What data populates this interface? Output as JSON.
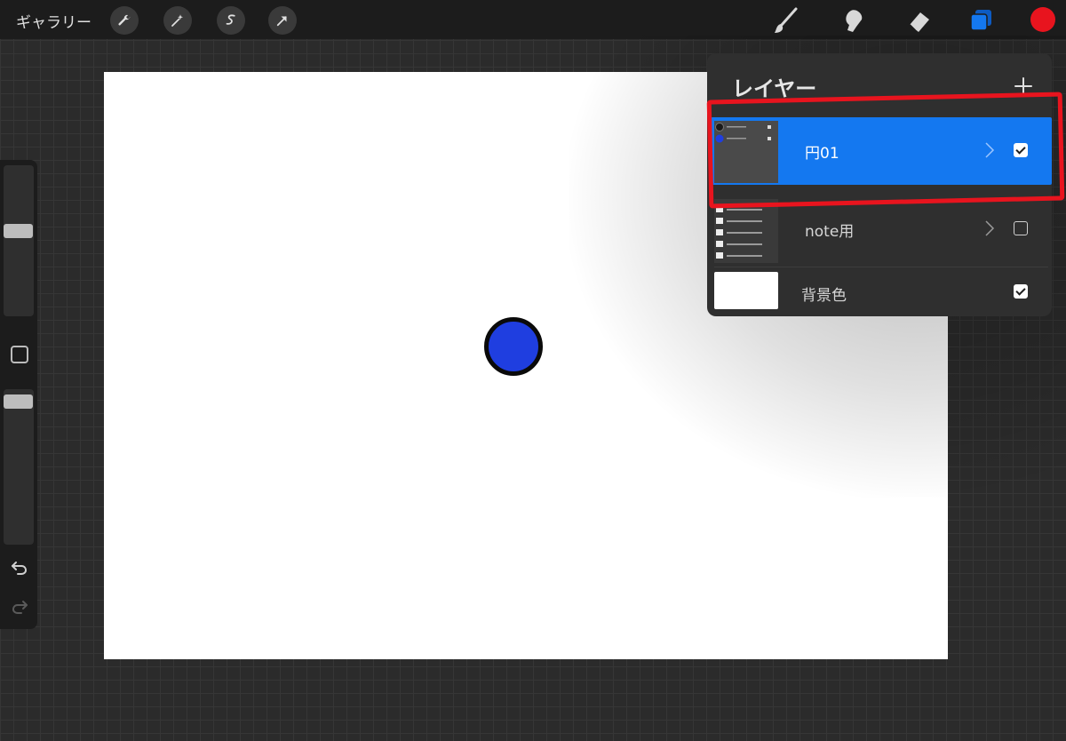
{
  "toolbar": {
    "gallery_label": "ギャラリー",
    "left_tools": [
      {
        "name": "wrench-icon"
      },
      {
        "name": "magic-wand-icon"
      },
      {
        "name": "selection-icon"
      },
      {
        "name": "transform-arrow-icon"
      }
    ],
    "right_tools": [
      {
        "name": "brush-icon"
      },
      {
        "name": "smudge-icon"
      },
      {
        "name": "eraser-icon"
      },
      {
        "name": "layers-icon"
      }
    ],
    "current_color": "#e8141e",
    "layers_accent": "#1478f0"
  },
  "canvas": {
    "background": "#ffffff",
    "circle_fill": "#1f3ee0",
    "circle_stroke": "#0a0a0a"
  },
  "layers_panel": {
    "title": "レイヤー",
    "add_icon": "plus-icon",
    "layers": [
      {
        "name": "円01",
        "type": "group",
        "selected": true,
        "visible": true
      },
      {
        "name": "note用",
        "type": "group",
        "selected": false,
        "visible": false
      },
      {
        "name": "背景色",
        "type": "background",
        "selected": false,
        "visible": true
      }
    ]
  },
  "annotation": {
    "highlight_color": "#e8141e"
  }
}
